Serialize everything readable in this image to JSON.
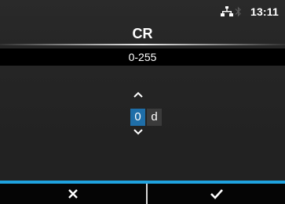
{
  "status": {
    "time": "13:11",
    "icons": [
      "network-icon",
      "bluetooth-icon"
    ]
  },
  "title": "CR",
  "range": "0-255",
  "editor": {
    "value": "0",
    "unit": "d",
    "up_icon": "chevron-up-icon",
    "down_icon": "chevron-down-icon"
  },
  "footer": {
    "cancel_icon": "close-icon",
    "ok_icon": "check-icon"
  },
  "colors": {
    "accent": "#1fa3e0",
    "selected_digit": "#1f6ea8"
  }
}
